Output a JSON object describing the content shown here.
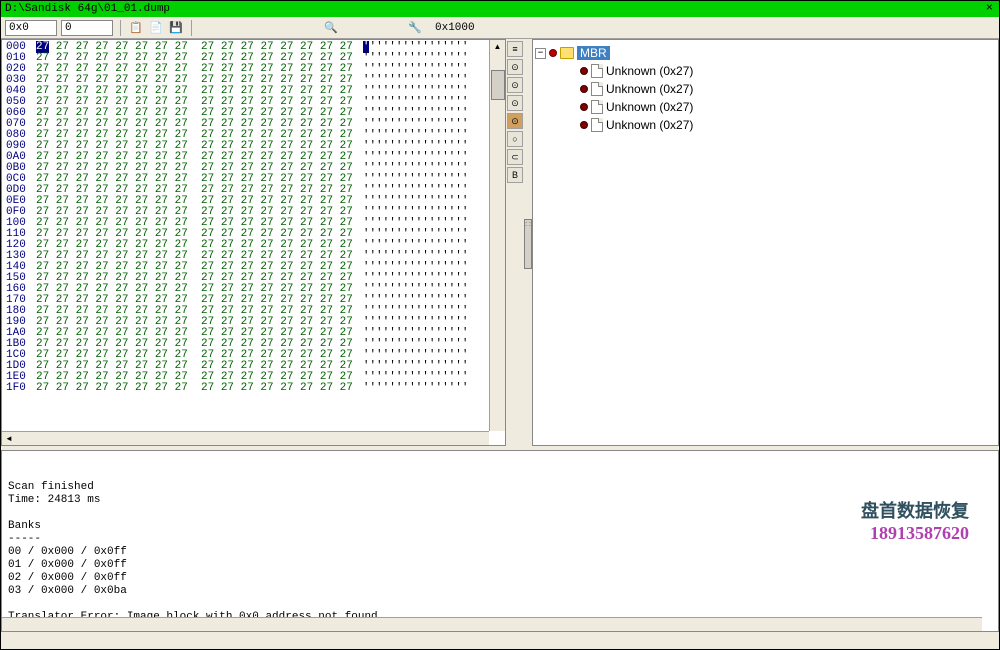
{
  "window": {
    "title": "D:\\Sandisk 64g\\01_01.dump"
  },
  "toolbar": {
    "offset_value": "0x0",
    "size_value": "0",
    "address_label": "0x1000"
  },
  "hex": {
    "offsets": [
      "000",
      "010",
      "020",
      "030",
      "040",
      "050",
      "060",
      "070",
      "080",
      "090",
      "0A0",
      "0B0",
      "0C0",
      "0D0",
      "0E0",
      "0F0",
      "100",
      "110",
      "120",
      "130",
      "140",
      "150",
      "160",
      "170",
      "180",
      "190",
      "1A0",
      "1B0",
      "1C0",
      "1D0",
      "1E0",
      "1F0"
    ],
    "byte_value": "27",
    "ascii_char": "'",
    "cols": 16
  },
  "vtoolbar": {
    "labels": [
      "≡",
      "⊙",
      "⊙",
      "⊙",
      "⊙",
      "○",
      "⊂",
      "B"
    ]
  },
  "tree": {
    "root": {
      "label": "MBR"
    },
    "children": [
      {
        "label": "Unknown (0x27)"
      },
      {
        "label": "Unknown (0x27)"
      },
      {
        "label": "Unknown (0x27)"
      },
      {
        "label": "Unknown (0x27)"
      }
    ]
  },
  "log": {
    "lines": [
      "Scan finished",
      "Time: 24813 ms",
      "",
      "Banks",
      "-----",
      "00 / 0x000 / 0x0ff",
      "01 / 0x000 / 0x0ff",
      "02 / 0x000 / 0x0ff",
      "03 / 0x000 / 0x0ba",
      "",
      "Translator Error: Image block with 0x0 address not found"
    ]
  },
  "watermark": {
    "line1": "盘首数据恢复",
    "line2": "18913587620"
  }
}
